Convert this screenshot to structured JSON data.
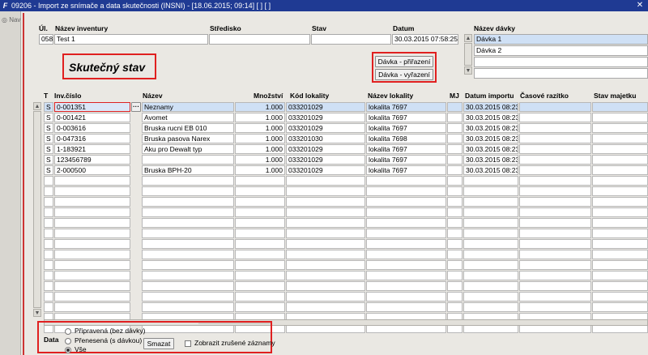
{
  "window": {
    "title": "09206 - Import ze snímače a data skutečnosti (INSNI) - [18.06.2015; 09:14]  [ ]  [ ]",
    "app_icon": "F",
    "close_icon": "✕"
  },
  "nav": {
    "label": "Nav"
  },
  "header": {
    "labels": {
      "ul": "Úl.",
      "inventory_name": "Název inventury",
      "center": "Středisko",
      "state": "Stav",
      "date": "Datum",
      "batch_name": "Název dávky"
    },
    "values": {
      "ul": "058",
      "inventory_name": "Test 1",
      "center": "",
      "state": "",
      "date": "30.03.2015 07:58:25"
    },
    "batches": [
      "Dávka 1",
      "Dávka 2",
      "",
      ""
    ]
  },
  "section_title": "Skutečný stav",
  "buttons": {
    "assign_batch": "Dávka - přiřazení",
    "remove_batch": "Dávka - vyřazení",
    "delete": "Smazat",
    "ellipsis": "···"
  },
  "grid": {
    "columns": [
      "T",
      "Inv.číslo",
      "Název",
      "Množství",
      "Kód lokality",
      "Název lokality",
      "MJ",
      "Datum importu",
      "Časové razítko",
      "Stav majetku"
    ],
    "rows": [
      [
        "S",
        "0-001351",
        "Neznamy",
        "1.000",
        "033201029",
        "lokalita 7697",
        "",
        "30.03.2015 08:23:5",
        "",
        ""
      ],
      [
        "S",
        "0-001421",
        "Avomet",
        "1.000",
        "033201029",
        "lokalita 7697",
        "",
        "30.03.2015 08:23:5",
        "",
        ""
      ],
      [
        "S",
        "0-003616",
        "Bruska rucni EB 010",
        "1.000",
        "033201029",
        "lokalita 7697",
        "",
        "30.03.2015 08:23:5",
        "",
        ""
      ],
      [
        "S",
        "0-047316",
        "Bruska pasova Narex",
        "1.000",
        "033201030",
        "lokalita 7698",
        "",
        "30.03.2015 08:23:5",
        "",
        ""
      ],
      [
        "S",
        "1-183921",
        "Aku pro Dewalt typ",
        "1.000",
        "033201029",
        "lokalita 7697",
        "",
        "30.03.2015 08:23:5",
        "",
        ""
      ],
      [
        "S",
        "123456789",
        "",
        "1.000",
        "033201029",
        "lokalita 7697",
        "",
        "30.03.2015 08:23:5",
        "",
        ""
      ],
      [
        "S",
        "2-000500",
        "Bruska BPH-20",
        "1.000",
        "033201029",
        "lokalita 7697",
        "",
        "30.03.2015 08:23:5",
        "",
        ""
      ]
    ],
    "empty_rows": 15
  },
  "filter": {
    "label": "Data",
    "options": [
      "Připravená (bez dávky)",
      "Přenesená (s dávkou)",
      "Vše"
    ],
    "selected": 2,
    "show_cancelled": "Zobrazit zrušené záznamy"
  }
}
